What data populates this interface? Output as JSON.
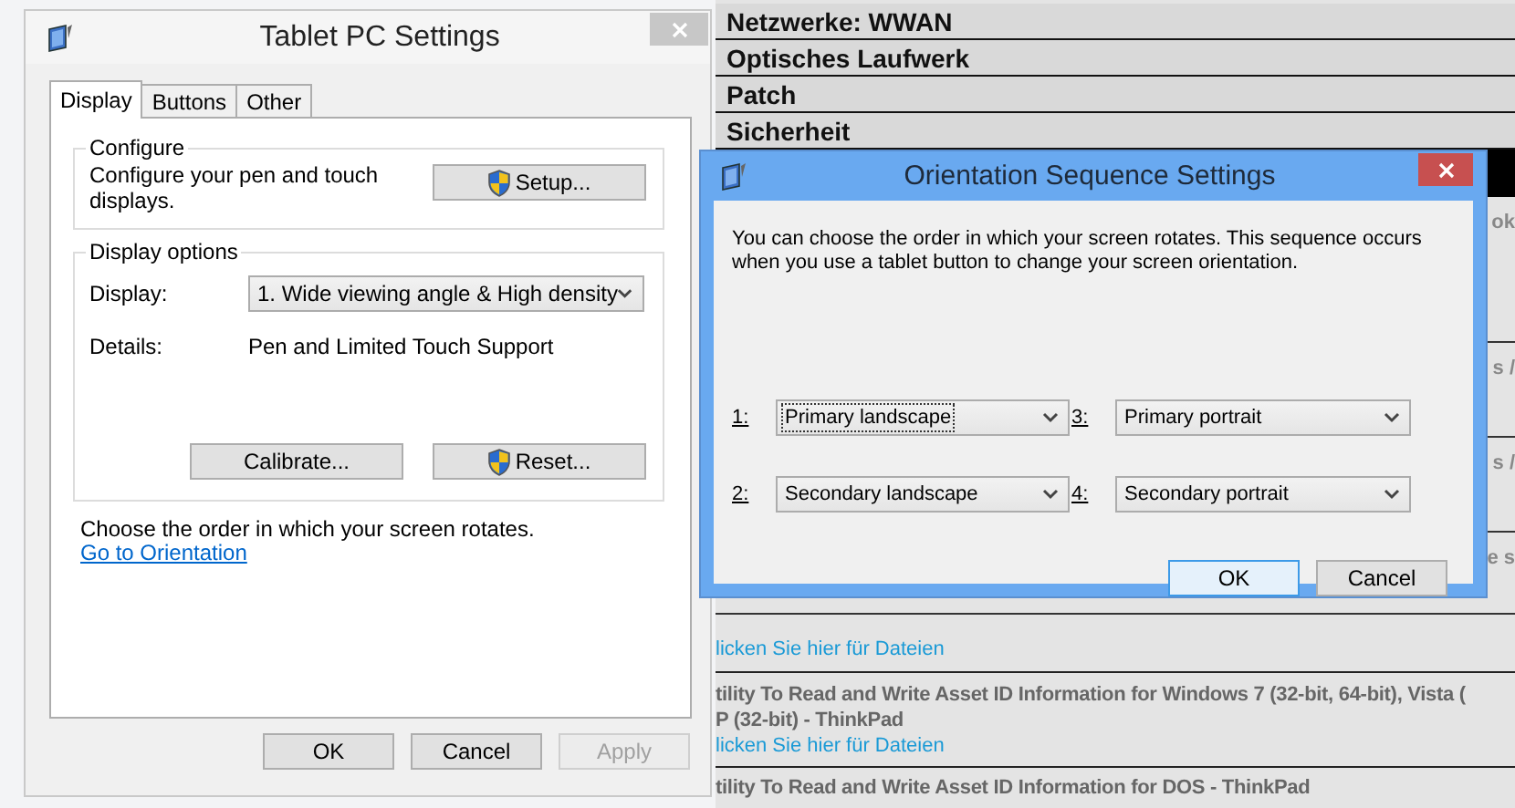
{
  "background_page": {
    "headings": [
      "Netzwerke: WWAN",
      "Optisches Laufwerk",
      "Patch",
      "Sicherheit"
    ],
    "edge_fragments": [
      "ok",
      "s /",
      "s /",
      "e s"
    ],
    "downloads": [
      {
        "link": "licken Sie hier für Dateien"
      },
      {
        "lines": [
          "tility To Read and Write Asset ID Information for Windows 7 (32-bit, 64-bit), Vista (",
          "P (32-bit) - ThinkPad"
        ],
        "link": "licken Sie hier für Dateien"
      },
      {
        "lines": [
          "tility To Read and Write Asset ID Information for DOS - ThinkPad"
        ]
      }
    ]
  },
  "tablet_settings": {
    "title": "Tablet PC Settings",
    "tabs": [
      {
        "label": "Display",
        "selected": true
      },
      {
        "label": "Buttons",
        "selected": false
      },
      {
        "label": "Other",
        "selected": false
      }
    ],
    "configure": {
      "legend": "Configure",
      "text": "Configure your pen and touch displays.",
      "button": {
        "label": "Setup...",
        "shield": true
      }
    },
    "display_options": {
      "legend": "Display options",
      "display_label": "Display:",
      "display_value": "1. Wide viewing angle & High density",
      "details_label": "Details:",
      "details_value": "Pen and Limited Touch Support",
      "buttons": [
        {
          "label": "Calibrate...",
          "shield": false
        },
        {
          "label": "Reset...",
          "shield": true
        }
      ]
    },
    "orientation_text": "Choose the order in which your screen rotates.",
    "orientation_link": "Go to Orientation",
    "buttons": [
      {
        "label": "OK",
        "disabled": false
      },
      {
        "label": "Cancel",
        "disabled": false
      },
      {
        "label": "Apply",
        "disabled": true
      }
    ]
  },
  "orientation_dialog": {
    "title": "Orientation Sequence Settings",
    "description": "You can choose the order in which your screen rotates. This sequence occurs when you use a tablet button to change your screen orientation.",
    "slots": [
      {
        "label": "1:",
        "value": "Primary landscape",
        "focused": true
      },
      {
        "label": "3:",
        "value": "Primary portrait",
        "focused": false
      },
      {
        "label": "2:",
        "value": "Secondary landscape",
        "focused": false
      },
      {
        "label": "4:",
        "value": "Secondary portrait",
        "focused": false
      }
    ],
    "buttons": [
      {
        "label": "OK",
        "default": true
      },
      {
        "label": "Cancel",
        "default": false
      }
    ]
  }
}
